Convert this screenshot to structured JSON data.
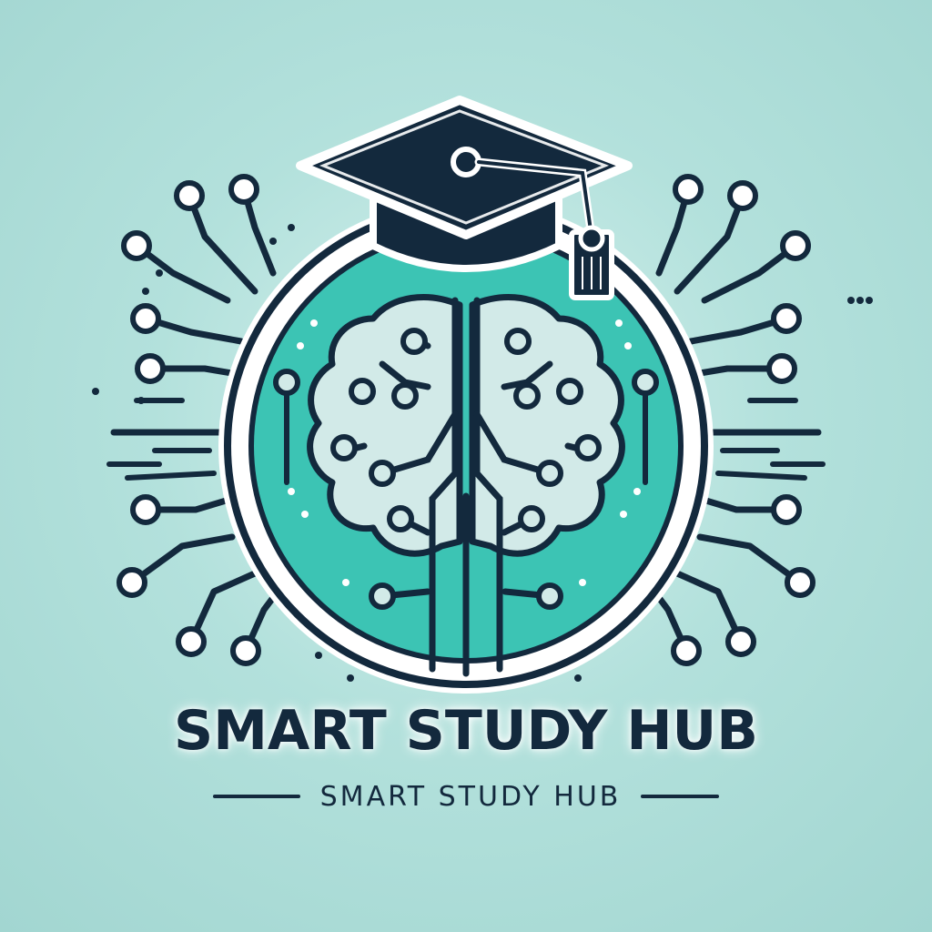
{
  "logo": {
    "title": "SMART STUDY HUB",
    "subtitle": "SMART STUDY HUB",
    "icons": [
      "graduation-cap-icon",
      "brain-circuit-icon",
      "circuit-traces"
    ]
  },
  "colors": {
    "background": "#a9dad5",
    "navy": "#13293d",
    "teal": "#3cc4b4",
    "brain_fill": "#d2eae8",
    "white": "#ffffff"
  }
}
